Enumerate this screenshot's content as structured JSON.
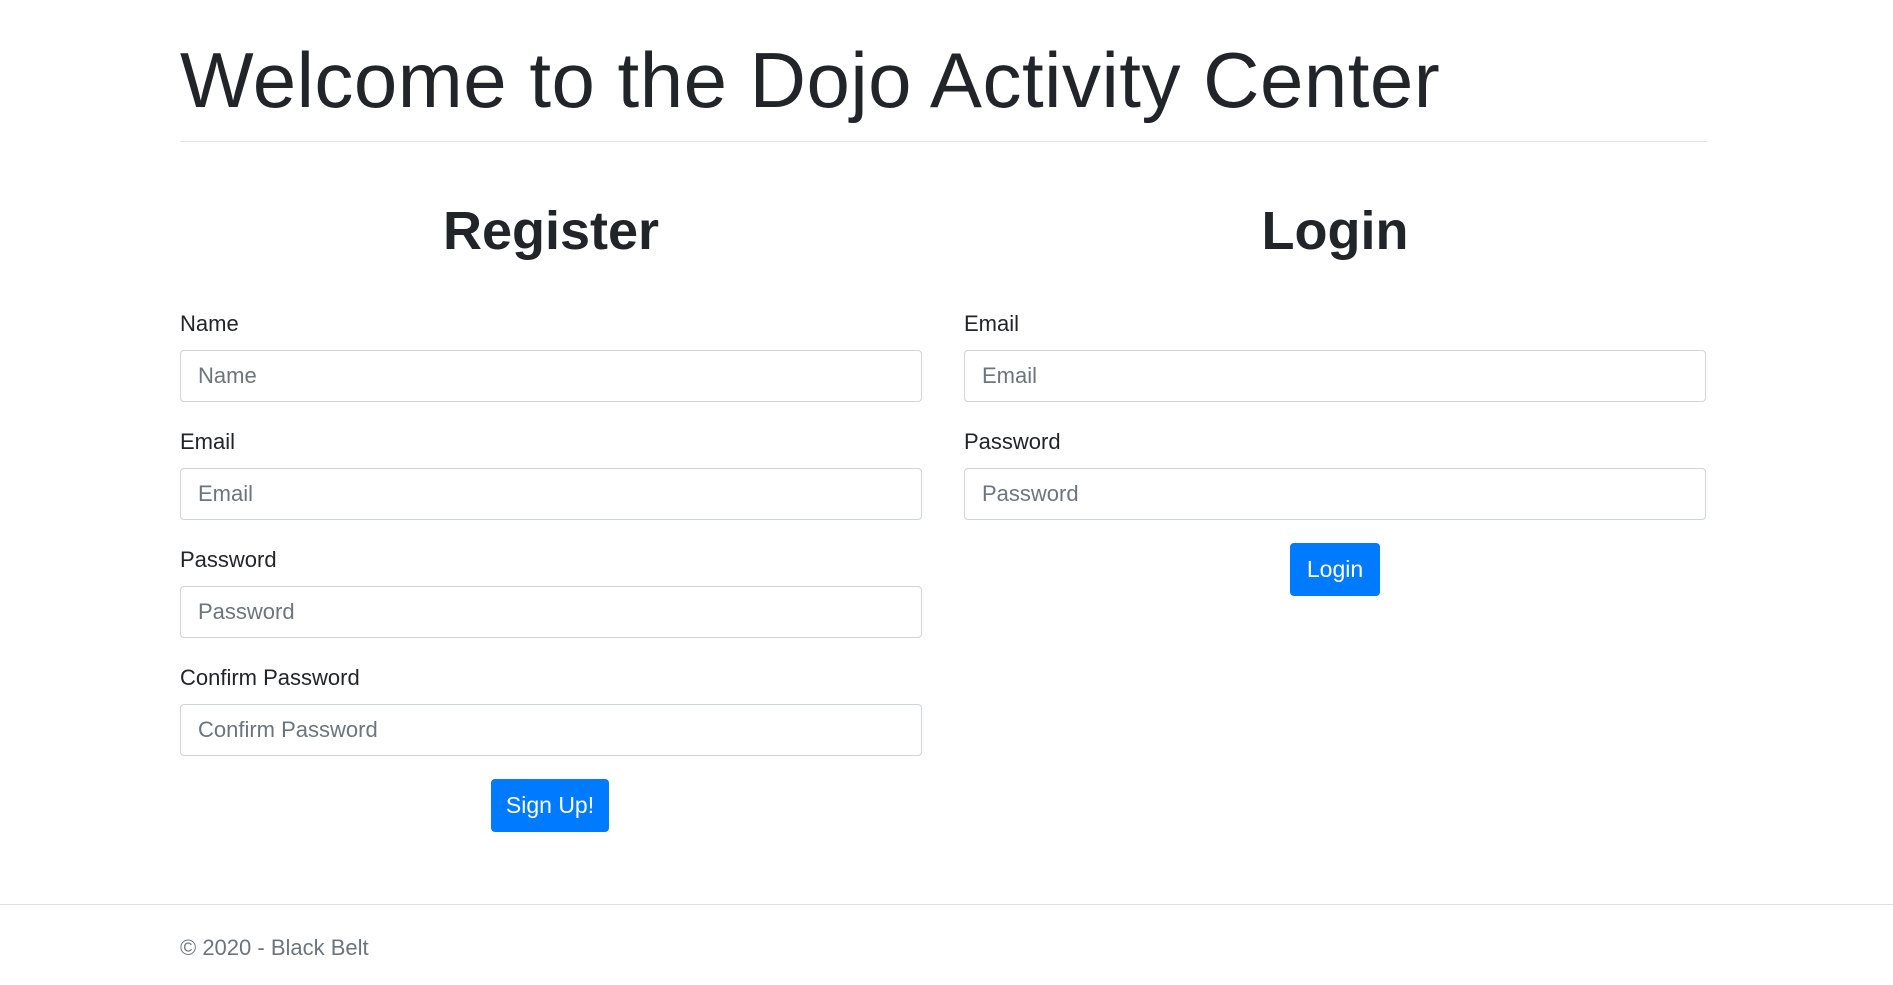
{
  "header": {
    "title": "Welcome to the Dojo Activity Center"
  },
  "register": {
    "heading": "Register",
    "fields": [
      {
        "label": "Name",
        "placeholder": "Name",
        "value": ""
      },
      {
        "label": "Email",
        "placeholder": "Email",
        "value": ""
      },
      {
        "label": "Password",
        "placeholder": "Password",
        "value": ""
      },
      {
        "label": "Confirm Password",
        "placeholder": "Confirm Password",
        "value": ""
      }
    ],
    "submit_label": "Sign Up!"
  },
  "login": {
    "heading": "Login",
    "fields": [
      {
        "label": "Email",
        "placeholder": "Email",
        "value": ""
      },
      {
        "label": "Password",
        "placeholder": "Password",
        "value": ""
      }
    ],
    "submit_label": "Login"
  },
  "footer": {
    "text": "© 2020 - Black Belt"
  },
  "colors": {
    "primary_button": "#007bff",
    "text": "#212529",
    "muted_text": "#6c757d",
    "input_border": "#ced4da",
    "divider": "#dee2e6"
  }
}
